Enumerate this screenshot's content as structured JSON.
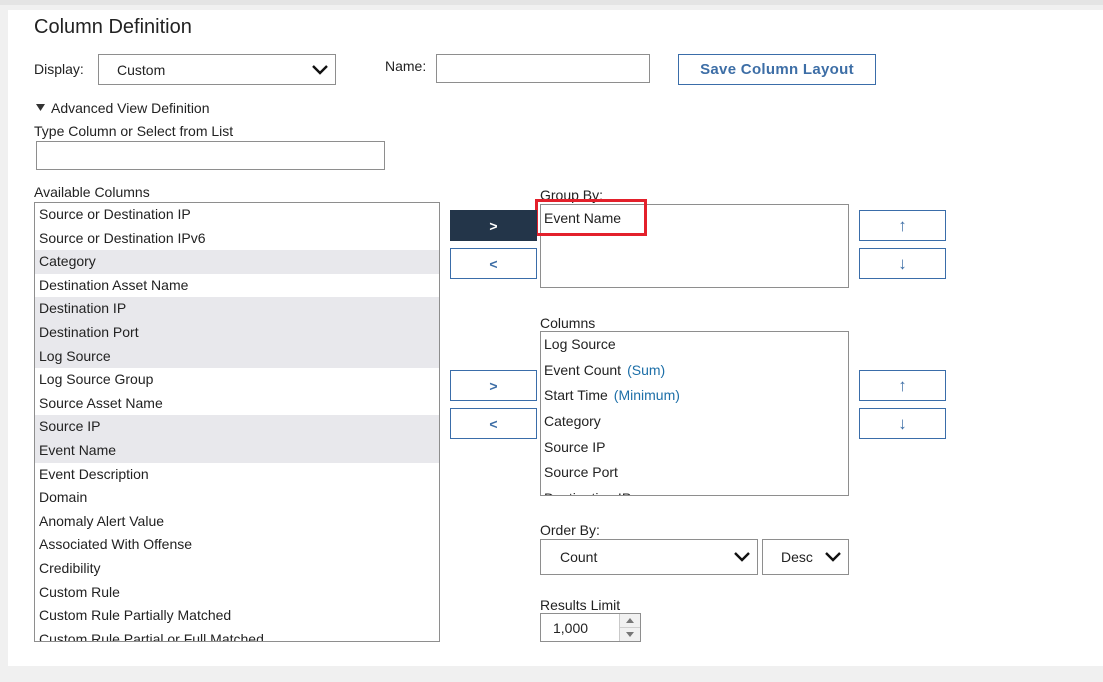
{
  "page": {
    "title": "Column Definition"
  },
  "display": {
    "label": "Display:",
    "value": "Custom"
  },
  "name": {
    "label": "Name:",
    "value": ""
  },
  "save_button": "Save Column Layout",
  "advanced": {
    "toggle_label": "Advanced View Definition",
    "type_label": "Type Column or Select from List",
    "type_value": ""
  },
  "available": {
    "label": "Available Columns",
    "items": [
      {
        "label": "Source or Destination IP",
        "selected": false
      },
      {
        "label": "Source or Destination IPv6",
        "selected": false
      },
      {
        "label": "Category",
        "selected": true
      },
      {
        "label": "Destination Asset Name",
        "selected": false
      },
      {
        "label": "Destination IP",
        "selected": true
      },
      {
        "label": "Destination Port",
        "selected": true
      },
      {
        "label": "Log Source",
        "selected": true
      },
      {
        "label": "Log Source Group",
        "selected": false
      },
      {
        "label": "Source Asset Name",
        "selected": false
      },
      {
        "label": "Source IP",
        "selected": true
      },
      {
        "label": "Event Name",
        "selected": true
      },
      {
        "label": "Event Description",
        "selected": false
      },
      {
        "label": "Domain",
        "selected": false
      },
      {
        "label": "Anomaly Alert Value",
        "selected": false
      },
      {
        "label": "Associated With Offense",
        "selected": false
      },
      {
        "label": "Credibility",
        "selected": false
      },
      {
        "label": "Custom Rule",
        "selected": false
      },
      {
        "label": "Custom Rule Partially Matched",
        "selected": false
      },
      {
        "label": "Custom Rule Partial or Full Matched",
        "selected": false
      }
    ]
  },
  "buttons": {
    "add": ">",
    "remove": "<",
    "up": "↑",
    "down": "↓"
  },
  "group_by": {
    "label": "Group By:",
    "items": [
      "Event Name"
    ]
  },
  "columns": {
    "label": "Columns",
    "items": [
      {
        "label": "Log Source",
        "agg": ""
      },
      {
        "label": "Event Count",
        "agg": "(Sum)"
      },
      {
        "label": "Start Time",
        "agg": "(Minimum)"
      },
      {
        "label": "Category",
        "agg": ""
      },
      {
        "label": "Source IP",
        "agg": ""
      },
      {
        "label": "Source Port",
        "agg": ""
      },
      {
        "label": "Destination IP",
        "agg": ""
      }
    ]
  },
  "order_by": {
    "label": "Order By:",
    "field": "Count",
    "direction": "Desc"
  },
  "results_limit": {
    "label": "Results Limit",
    "value": "1,000"
  },
  "icons": {
    "chevron": "chevron-down-icon",
    "triangle": "triangle-down-icon",
    "spin_up": "spin-up-icon",
    "spin_down": "spin-down-icon"
  }
}
